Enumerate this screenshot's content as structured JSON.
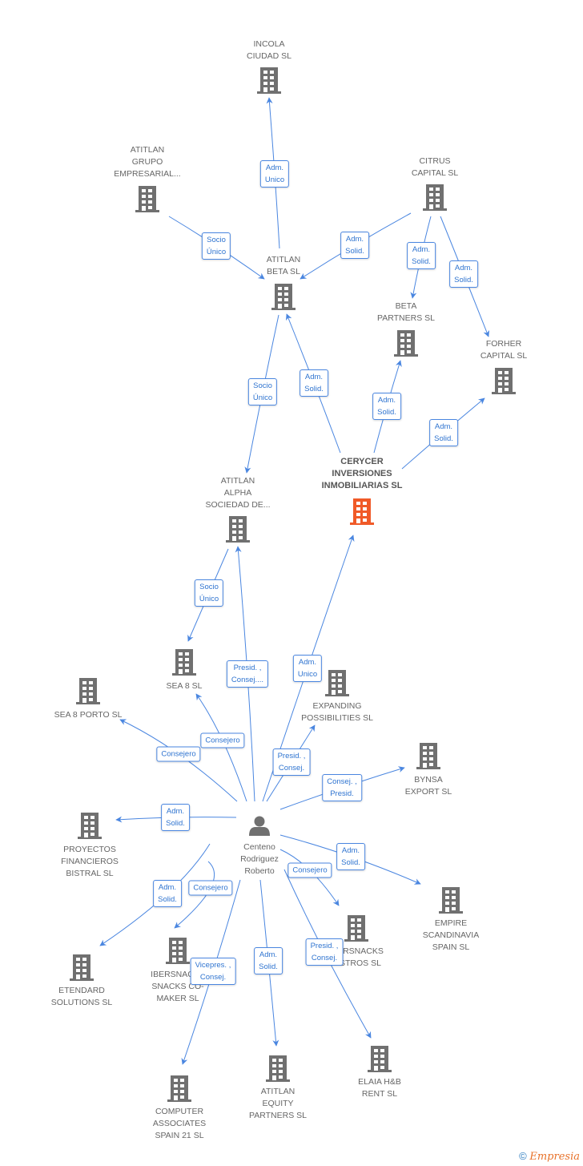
{
  "colors": {
    "edge": "#4a86e0",
    "building": "#707070",
    "focus_building": "#f05a28",
    "label": "#666666"
  },
  "nodes": [
    {
      "id": "incola",
      "type": "company",
      "lines": [
        "INCOLA",
        "CIUDAD SL"
      ]
    },
    {
      "id": "grupo",
      "type": "company",
      "lines": [
        "ATITLAN",
        "GRUPO",
        "EMPRESARIAL..."
      ]
    },
    {
      "id": "citrus",
      "type": "company",
      "lines": [
        "CITRUS",
        "CAPITAL SL"
      ]
    },
    {
      "id": "beta",
      "type": "company",
      "lines": [
        "ATITLAN",
        "BETA  SL"
      ]
    },
    {
      "id": "betap",
      "type": "company",
      "lines": [
        "BETA",
        "PARTNERS  SL"
      ]
    },
    {
      "id": "forher",
      "type": "company",
      "lines": [
        "FORHER",
        "CAPITAL  SL"
      ]
    },
    {
      "id": "cerycer",
      "type": "focus",
      "lines": [
        "CERYCER",
        "INVERSIONES",
        "INMOBILIARIAS SL"
      ]
    },
    {
      "id": "alpha",
      "type": "company",
      "lines": [
        "ATITLAN",
        "ALPHA",
        "SOCIEDAD DE..."
      ]
    },
    {
      "id": "sea8",
      "type": "company",
      "lines": [
        "SEA 8  SL"
      ]
    },
    {
      "id": "sea8p",
      "type": "company",
      "lines": [
        "SEA 8 PORTO SL"
      ]
    },
    {
      "id": "expanding",
      "type": "company",
      "lines": [
        "EXPANDING",
        "POSSIBILITIES SL"
      ]
    },
    {
      "id": "bynsa",
      "type": "company",
      "lines": [
        "BYNSA",
        "EXPORT  SL"
      ]
    },
    {
      "id": "proyectos",
      "type": "company",
      "lines": [
        "PROYECTOS",
        "FINANCIEROS",
        "BISTRAL SL"
      ]
    },
    {
      "id": "centeno",
      "type": "person",
      "lines": [
        "Centeno",
        "Rodriguez",
        "Roberto"
      ]
    },
    {
      "id": "empire",
      "type": "company",
      "lines": [
        "EMPIRE",
        "SCANDINAVIA",
        "SPAIN SL"
      ]
    },
    {
      "id": "bistros",
      "type": "company",
      "lines": [
        "IBERSNACKS",
        "BISTROS SL"
      ]
    },
    {
      "id": "etendard",
      "type": "company",
      "lines": [
        "ETENDARD",
        "SOLUTIONS SL"
      ]
    },
    {
      "id": "comaker",
      "type": "company",
      "lines": [
        "IBERSNACKS",
        "SNACKS CO-",
        "MAKER SL"
      ]
    },
    {
      "id": "computer",
      "type": "company",
      "lines": [
        "COMPUTER",
        "ASSOCIATES",
        "SPAIN 21 SL"
      ]
    },
    {
      "id": "equity",
      "type": "company",
      "lines": [
        "ATITLAN",
        "EQUITY",
        "PARTNERS SL"
      ]
    },
    {
      "id": "elaia",
      "type": "company",
      "lines": [
        "ELAIA H&B",
        "RENT  SL"
      ]
    }
  ],
  "edges": [
    {
      "from": "beta",
      "to": "incola",
      "label": [
        "Adm.",
        "Unico"
      ]
    },
    {
      "from": "grupo",
      "to": "beta",
      "label": [
        "Socio",
        "Único"
      ]
    },
    {
      "from": "citrus",
      "to": "beta",
      "label": [
        "Adm.",
        "Solid."
      ]
    },
    {
      "from": "citrus",
      "to": "betap",
      "label": [
        "Adm.",
        "Solid."
      ]
    },
    {
      "from": "citrus",
      "to": "forher",
      "label": [
        "Adm.",
        "Solid."
      ]
    },
    {
      "from": "beta",
      "to": "alpha",
      "label": [
        "Socio",
        "Único"
      ]
    },
    {
      "from": "cerycer",
      "to": "beta",
      "label": [
        "Adm.",
        "Solid."
      ]
    },
    {
      "from": "cerycer",
      "to": "betap",
      "label": [
        "Adm.",
        "Solid."
      ]
    },
    {
      "from": "cerycer",
      "to": "forher",
      "label": [
        "Adm.",
        "Solid."
      ]
    },
    {
      "from": "alpha",
      "to": "sea8",
      "label": [
        "Socio",
        "Único"
      ]
    },
    {
      "from": "centeno",
      "to": "alpha",
      "label": [
        "Presid. ,",
        "Consej...."
      ]
    },
    {
      "from": "centeno",
      "to": "cerycer",
      "label": [
        "Adm.",
        "Unico"
      ]
    },
    {
      "from": "centeno",
      "to": "sea8",
      "label": [
        "Consejero"
      ]
    },
    {
      "from": "centeno",
      "to": "sea8p",
      "label": [
        "Consejero"
      ]
    },
    {
      "from": "centeno",
      "to": "expanding",
      "label": [
        "Presid. ,",
        "Consej."
      ]
    },
    {
      "from": "centeno",
      "to": "bynsa",
      "label": [
        "Consej. ,",
        "Presid."
      ]
    },
    {
      "from": "centeno",
      "to": "proyectos",
      "label": [
        "Adm.",
        "Solid."
      ]
    },
    {
      "from": "centeno",
      "to": "empire",
      "label": [
        "Adm.",
        "Solid."
      ]
    },
    {
      "from": "centeno",
      "to": "bistros",
      "label": [
        "Consejero"
      ]
    },
    {
      "from": "centeno",
      "to": "etendard",
      "label": [
        "Adm.",
        "Solid."
      ]
    },
    {
      "from": "centeno",
      "to": "comaker",
      "label": [
        "Consejero"
      ]
    },
    {
      "from": "centeno",
      "to": "computer",
      "label": [
        "Vicepres. ,",
        "Consej."
      ]
    },
    {
      "from": "centeno",
      "to": "equity",
      "label": [
        "Adm.",
        "Solid."
      ]
    },
    {
      "from": "centeno",
      "to": "elaia",
      "label": [
        "Presid. ,",
        "Consej."
      ]
    }
  ],
  "footer": {
    "copyright": "©",
    "brand": "Empresia"
  }
}
